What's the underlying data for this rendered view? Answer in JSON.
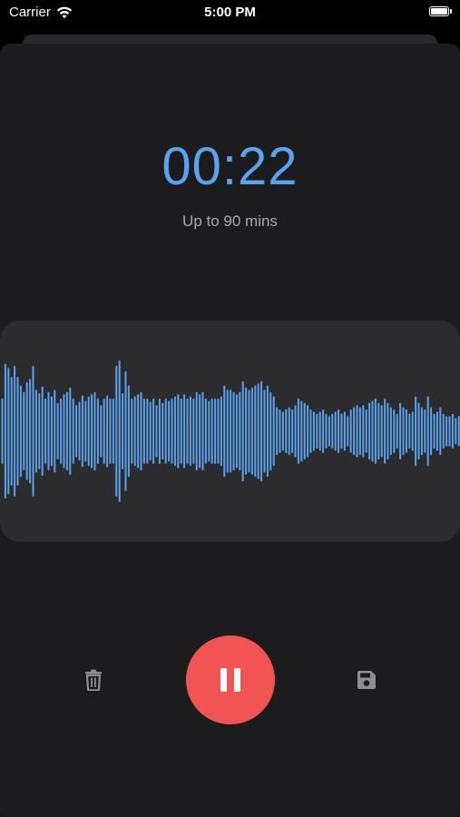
{
  "status_bar": {
    "carrier": "Carrier",
    "time": "5:00 PM"
  },
  "recorder": {
    "elapsed": "00:22",
    "limit_text": "Up to 90 mins"
  },
  "waveform": {
    "color": "#5aa1ee",
    "amplitudes": [
      0.3,
      0.62,
      0.58,
      0.5,
      0.6,
      0.5,
      0.42,
      0.36,
      0.45,
      0.48,
      0.6,
      0.38,
      0.35,
      0.41,
      0.3,
      0.36,
      0.32,
      0.38,
      0.26,
      0.3,
      0.34,
      0.36,
      0.4,
      0.3,
      0.24,
      0.27,
      0.33,
      0.28,
      0.32,
      0.34,
      0.36,
      0.3,
      0.24,
      0.3,
      0.33,
      0.3,
      0.3,
      0.6,
      0.65,
      0.35,
      0.55,
      0.42,
      0.3,
      0.32,
      0.34,
      0.36,
      0.3,
      0.3,
      0.27,
      0.3,
      0.24,
      0.3,
      0.26,
      0.3,
      0.28,
      0.3,
      0.32,
      0.34,
      0.3,
      0.34,
      0.3,
      0.32,
      0.3,
      0.36,
      0.34,
      0.36,
      0.3,
      0.28,
      0.3,
      0.3,
      0.3,
      0.32,
      0.42,
      0.38,
      0.38,
      0.36,
      0.34,
      0.36,
      0.46,
      0.4,
      0.38,
      0.4,
      0.42,
      0.44,
      0.46,
      0.38,
      0.42,
      0.36,
      0.32,
      0.22,
      0.2,
      0.18,
      0.2,
      0.22,
      0.2,
      0.24,
      0.3,
      0.28,
      0.26,
      0.24,
      0.2,
      0.18,
      0.16,
      0.18,
      0.2,
      0.16,
      0.14,
      0.16,
      0.18,
      0.2,
      0.16,
      0.18,
      0.14,
      0.2,
      0.22,
      0.24,
      0.22,
      0.24,
      0.2,
      0.26,
      0.28,
      0.3,
      0.26,
      0.24,
      0.3,
      0.26,
      0.22,
      0.2,
      0.16,
      0.26,
      0.22,
      0.2,
      0.16,
      0.18,
      0.32,
      0.26,
      0.22,
      0.2,
      0.32,
      0.22,
      0.16,
      0.18,
      0.22,
      0.16,
      0.14,
      0.14,
      0.16,
      0.12,
      0.14,
      0.12
    ]
  },
  "controls": {
    "delete_icon": "trash-icon",
    "record_icon": "pause-icon",
    "save_icon": "floppy-disk-icon",
    "record_color": "#f25454"
  }
}
